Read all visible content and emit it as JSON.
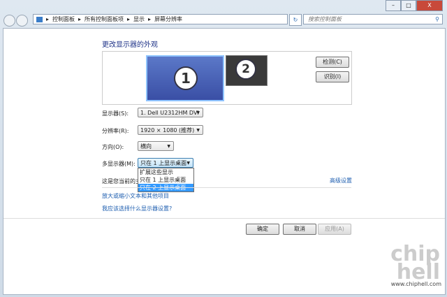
{
  "window": {
    "minimize": "–",
    "maximize": "□",
    "close": "X"
  },
  "address": {
    "crumbs": [
      "控制面板",
      "所有控制面板项",
      "显示",
      "屏幕分辨率"
    ],
    "search_placeholder": "搜索控制面板"
  },
  "page": {
    "title": "更改显示器的外观",
    "monitors": [
      "1",
      "2"
    ],
    "detect": "检测(C)",
    "identify": "识别(I)",
    "display_label": "显示器(S):",
    "display_value": "1. Dell U2312HM DVI",
    "resolution_label": "分辨率(R):",
    "resolution_value": "1920 × 1080 (推荐)",
    "orientation_label": "方向(O):",
    "orientation_value": "横向",
    "multi_label": "多显示器(M):",
    "multi_value": "只在 1 上显示桌面",
    "multi_options": [
      "扩展这些显示",
      "只在 1 上显示桌面",
      "只在 2 上显示桌面"
    ],
    "current_text": "这是您当前的主",
    "advanced": "高级设置",
    "link1": "放大或缩小文本和其他项目",
    "link2": "我应该选择什么显示器设置?",
    "ok": "确定",
    "cancel": "取消",
    "apply": "应用(A)"
  },
  "watermark": {
    "logo": "chip hell",
    "url": "www.chiphell.com"
  }
}
